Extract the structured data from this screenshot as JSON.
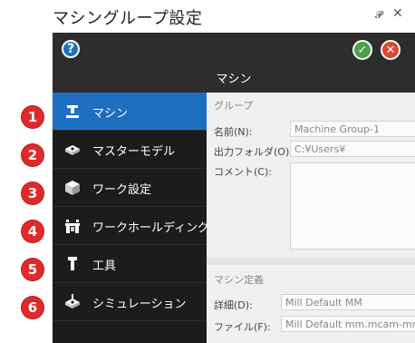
{
  "panel": {
    "title": "マシングループ設定",
    "pin_icon": "pin-icon",
    "close_icon": "close-icon"
  },
  "header": {
    "title": "マシン",
    "help_label": "?",
    "ok_label": "✓",
    "cancel_label": "✕"
  },
  "sidebar": {
    "items": [
      {
        "label": "マシン",
        "icon": "machine-icon",
        "badge": "1",
        "active": true
      },
      {
        "label": "マスターモデル",
        "icon": "master-model-icon",
        "badge": "2",
        "active": false
      },
      {
        "label": "ワーク設定",
        "icon": "stock-setup-icon",
        "badge": "3",
        "active": false
      },
      {
        "label": "ワークホールディング",
        "icon": "workholding-icon",
        "badge": "4",
        "active": false
      },
      {
        "label": "工具",
        "icon": "tool-icon",
        "badge": "5",
        "active": false
      },
      {
        "label": "シミュレーション",
        "icon": "simulation-icon",
        "badge": "6",
        "active": false
      }
    ]
  },
  "group": {
    "title": "グループ",
    "name_label": "名前(N):",
    "name_value": "Machine Group-1",
    "output_label": "出力フォルダ(O):",
    "output_value": "C:¥Users¥",
    "comment_label": "コメント(C):",
    "comment_value": ""
  },
  "machine_def": {
    "title": "マシン定義",
    "detail_label": "詳細(D):",
    "detail_value": "Mill Default MM",
    "file_label": "ファイル(F):",
    "file_value": "Mill Default mm.mcam-mmd"
  },
  "colors": {
    "accent": "#1e6fc0",
    "badge": "#e02a2a",
    "ok": "#4aa24a",
    "cancel": "#d9482f"
  }
}
